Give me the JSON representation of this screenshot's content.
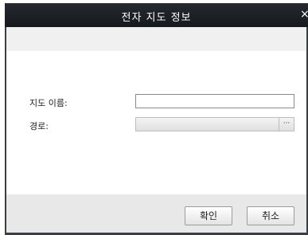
{
  "dialog": {
    "title": "전자 지도 정보",
    "close_glyph": "×"
  },
  "form": {
    "name_label": "지도 이름:",
    "name_value": "",
    "path_label": "경로:",
    "path_value": "",
    "browse_label": "···"
  },
  "buttons": {
    "ok_label": "확인",
    "cancel_label": "취소"
  },
  "colors": {
    "titlebar": "#1d2025",
    "footer": "#e8e8e8",
    "top_band": "#f0f0f0"
  },
  "icons": [
    "close-icon"
  ]
}
